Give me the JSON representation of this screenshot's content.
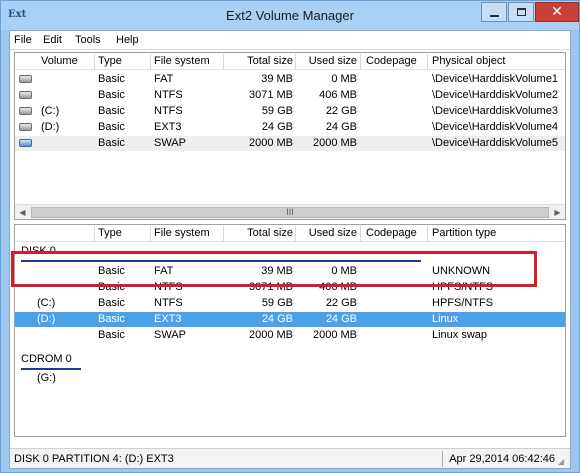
{
  "window": {
    "title": "Ext2 Volume Manager",
    "app_icon_text": "Ext",
    "close_glyph": "✕"
  },
  "menu": [
    "File",
    "Edit",
    "Tools",
    "Help"
  ],
  "volumes": {
    "columns": [
      "Volume",
      "Type",
      "File system",
      "Total size",
      "Used size",
      "Codepage",
      "Physical object"
    ],
    "rows": [
      {
        "volume": "",
        "type": "Basic",
        "fs": "FAT",
        "total": "39 MB",
        "used": "0 MB",
        "codepage": "",
        "physical": "\\Device\\HarddiskVolume1",
        "icon": "drive-icon"
      },
      {
        "volume": "",
        "type": "Basic",
        "fs": "NTFS",
        "total": "3071 MB",
        "used": "406 MB",
        "codepage": "",
        "physical": "\\Device\\HarddiskVolume2",
        "icon": "drive-icon"
      },
      {
        "volume": "(C:)",
        "type": "Basic",
        "fs": "NTFS",
        "total": "59 GB",
        "used": "22 GB",
        "codepage": "",
        "physical": "\\Device\\HarddiskVolume3",
        "icon": "drive-icon"
      },
      {
        "volume": "(D:)",
        "type": "Basic",
        "fs": "EXT3",
        "total": "24 GB",
        "used": "24 GB",
        "codepage": "",
        "physical": "\\Device\\HarddiskVolume4",
        "icon": "drive-icon"
      },
      {
        "volume": "",
        "type": "Basic",
        "fs": "SWAP",
        "total": "2000 MB",
        "used": "2000 MB",
        "codepage": "",
        "physical": "\\Device\\HarddiskVolume5",
        "icon": "drive-icon"
      }
    ],
    "scroll_grip": "III"
  },
  "disks": {
    "columns": [
      "",
      "Type",
      "File system",
      "Total size",
      "Used size",
      "Codepage",
      "Partition type"
    ],
    "disk0_label": "DISK 0",
    "disk0_rows": [
      {
        "volume": "",
        "type": "Basic",
        "fs": "FAT",
        "total": "39 MB",
        "used": "0 MB",
        "codepage": "",
        "ptype": "UNKNOWN"
      },
      {
        "volume": "",
        "type": "Basic",
        "fs": "NTFS",
        "total": "3071 MB",
        "used": "406 MB",
        "codepage": "",
        "ptype": "HPFS/NTFS"
      },
      {
        "volume": "(C:)",
        "type": "Basic",
        "fs": "NTFS",
        "total": "59 GB",
        "used": "22 GB",
        "codepage": "",
        "ptype": "HPFS/NTFS"
      },
      {
        "volume": "(D:)",
        "type": "Basic",
        "fs": "EXT3",
        "total": "24 GB",
        "used": "24 GB",
        "codepage": "",
        "ptype": "Linux"
      },
      {
        "volume": "",
        "type": "Basic",
        "fs": "SWAP",
        "total": "2000 MB",
        "used": "2000 MB",
        "codepage": "",
        "ptype": "Linux swap"
      }
    ],
    "cdrom_label": "CDROM 0",
    "cdrom_rows": [
      {
        "volume": "(G:)"
      }
    ]
  },
  "status": {
    "left": "DISK 0 PARTITION 4: (D:) EXT3",
    "right": "Apr 29,2014 06:42:46"
  },
  "colors": {
    "selection": "#4aa1e8",
    "highlight_box": "#d11f2c",
    "group_line": "#1f3b9a"
  }
}
